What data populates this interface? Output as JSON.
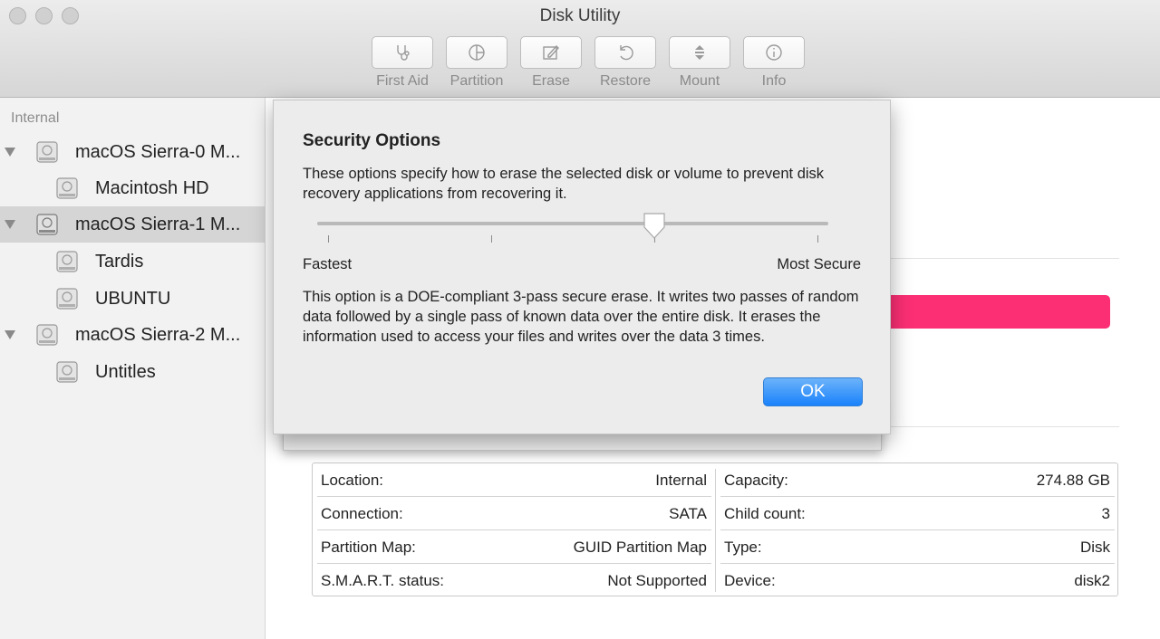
{
  "window": {
    "title": "Disk Utility"
  },
  "toolbar": {
    "items": [
      {
        "label": "First Aid",
        "icon": "stethoscope-icon"
      },
      {
        "label": "Partition",
        "icon": "partition-pie-icon"
      },
      {
        "label": "Erase",
        "icon": "erase-icon"
      },
      {
        "label": "Restore",
        "icon": "restore-icon"
      },
      {
        "label": "Mount",
        "icon": "mount-icon"
      },
      {
        "label": "Info",
        "icon": "info-icon"
      }
    ]
  },
  "sidebar": {
    "section": "Internal",
    "items": [
      {
        "label": "macOS Sierra-0 M...",
        "level": 0,
        "expanded": true,
        "selected": false
      },
      {
        "label": "Macintosh HD",
        "level": 1,
        "selected": false
      },
      {
        "label": "macOS Sierra-1 M...",
        "level": 0,
        "expanded": true,
        "selected": true
      },
      {
        "label": "Tardis",
        "level": 1,
        "selected": false
      },
      {
        "label": "UBUNTU",
        "level": 1,
        "selected": false
      },
      {
        "label": "macOS Sierra-2 M...",
        "level": 0,
        "expanded": true,
        "selected": false
      },
      {
        "label": "Untitles",
        "level": 1,
        "selected": false
      }
    ]
  },
  "dialog": {
    "title": "Security Options",
    "description": "These options specify how to erase the selected disk or volume to prevent disk recovery applications from recovering it.",
    "slider": {
      "min_label": "Fastest",
      "max_label": "Most Secure",
      "steps": 4,
      "selected_step": 3
    },
    "explanation": "This option is a DOE-compliant 3-pass secure erase. It writes two passes of random data followed by a single pass of known data over the entire disk. It erases the information used to access your files and writes over the data 3 times.",
    "ok_label": "OK"
  },
  "info": {
    "left": [
      {
        "key": "Location:",
        "value": "Internal"
      },
      {
        "key": "Connection:",
        "value": "SATA"
      },
      {
        "key": "Partition Map:",
        "value": "GUID Partition Map"
      },
      {
        "key": "S.M.A.R.T. status:",
        "value": "Not Supported"
      }
    ],
    "right": [
      {
        "key": "Capacity:",
        "value": "274.88 GB"
      },
      {
        "key": "Child count:",
        "value": "3"
      },
      {
        "key": "Type:",
        "value": "Disk"
      },
      {
        "key": "Device:",
        "value": "disk2"
      }
    ]
  },
  "colors": {
    "accent": "#1a82fb",
    "usage_bar": "#fc2f74",
    "selection": "#d5d5d5"
  }
}
